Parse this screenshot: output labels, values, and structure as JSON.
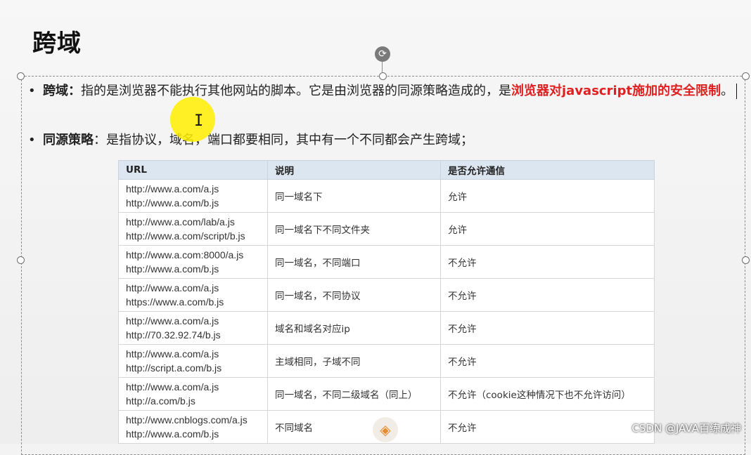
{
  "slide": {
    "title": "跨域",
    "bullet1": {
      "term": "跨域：",
      "text": "指的是浏览器不能执行其他网站的脚本。它是由浏览器的同源策略造成的，是",
      "highlight": "浏览器对javascript施加的安全限制",
      "end": "。"
    },
    "bullet2": {
      "term": "同源策略",
      "text": "：是指协议，域名，端口都要相同，其中有一个不同都会产生跨域；"
    }
  },
  "table": {
    "headers": [
      "URL",
      "说明",
      "是否允许通信"
    ],
    "rows": [
      {
        "url1": "http://www.a.com/a.js",
        "url2": "http://www.a.com/b.js",
        "desc": "同一域名下",
        "allow": "允许"
      },
      {
        "url1": "http://www.a.com/lab/a.js",
        "url2": "http://www.a.com/script/b.js",
        "desc": "同一域名下不同文件夹",
        "allow": "允许"
      },
      {
        "url1": "http://www.a.com:8000/a.js",
        "url2": "http://www.a.com/b.js",
        "desc": "同一域名，不同端口",
        "allow": "不允许"
      },
      {
        "url1": "http://www.a.com/a.js",
        "url2": "https://www.a.com/b.js",
        "desc": "同一域名，不同协议",
        "allow": "不允许"
      },
      {
        "url1": "http://www.a.com/a.js",
        "url2": "http://70.32.92.74/b.js",
        "desc": "域名和域名对应ip",
        "allow": "不允许"
      },
      {
        "url1": "http://www.a.com/a.js",
        "url2": "http://script.a.com/b.js",
        "desc": "主域相同，子域不同",
        "allow": "不允许"
      },
      {
        "url1": "http://www.a.com/a.js",
        "url2": "http://a.com/b.js",
        "desc": "同一域名，不同二级域名（同上）",
        "allow": "不允许（cookie这种情况下也不允许访问）"
      },
      {
        "url1": "http://www.cnblogs.com/a.js",
        "url2": "http://www.a.com/b.js",
        "desc": "不同域名",
        "allow": "不允许"
      }
    ]
  },
  "watermark": "CSDN @JAVA百练成神",
  "icons": {
    "rotate": "rotate-icon",
    "cursor": "text-cursor-icon",
    "logo": "logo-icon"
  }
}
